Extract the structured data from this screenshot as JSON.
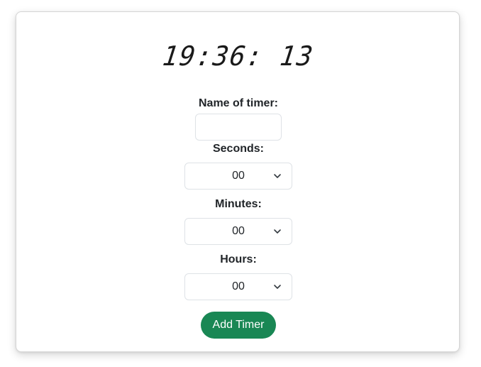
{
  "clock": {
    "time": "19:36: 13"
  },
  "form": {
    "name_label": "Name of timer:",
    "name_value": "",
    "seconds_label": "Seconds:",
    "seconds_value": "00",
    "minutes_label": "Minutes:",
    "minutes_value": "00",
    "hours_label": "Hours:",
    "hours_value": "00",
    "submit_label": "Add Timer"
  },
  "icons": {
    "select_chevron": "chevron-down-icon"
  },
  "colors": {
    "primary_button": "#198754",
    "card_border": "#d5d5d5",
    "text": "#212529"
  }
}
